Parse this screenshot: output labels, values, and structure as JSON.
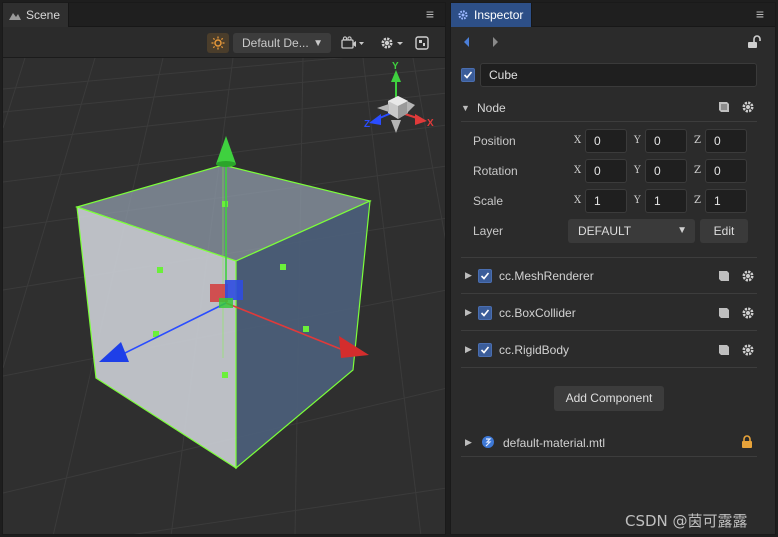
{
  "scene": {
    "tab_label": "Scene",
    "toolbar": {
      "camera_dropdown": "Default De..."
    },
    "gizmo_axes": {
      "x": "X",
      "y": "Y",
      "z": "Z"
    }
  },
  "inspector": {
    "tab_label": "Inspector",
    "node_name": "Cube",
    "node_section": "Node",
    "props": {
      "position": {
        "label": "Position",
        "x": "0",
        "y": "0",
        "z": "0"
      },
      "rotation": {
        "label": "Rotation",
        "x": "0",
        "y": "0",
        "z": "0"
      },
      "scale": {
        "label": "Scale",
        "x": "1",
        "y": "1",
        "z": "1"
      }
    },
    "axis_letters": {
      "x": "X",
      "y": "Y",
      "z": "Z"
    },
    "layer": {
      "label": "Layer",
      "value": "DEFAULT",
      "edit_label": "Edit"
    },
    "components": [
      {
        "label": "cc.MeshRenderer"
      },
      {
        "label": "cc.BoxCollider"
      },
      {
        "label": "cc.RigidBody"
      }
    ],
    "add_component_label": "Add Component",
    "material": {
      "label": "default-material.mtl"
    }
  },
  "watermark": "CSDN @茵可露露",
  "colors": {
    "accent_blue": "#2d4f87",
    "x_axis": "#e03a3a",
    "y_axis": "#3fd13f",
    "z_axis": "#2a4dff",
    "selection": "#7cff3a",
    "lock": "#e8a33a"
  }
}
